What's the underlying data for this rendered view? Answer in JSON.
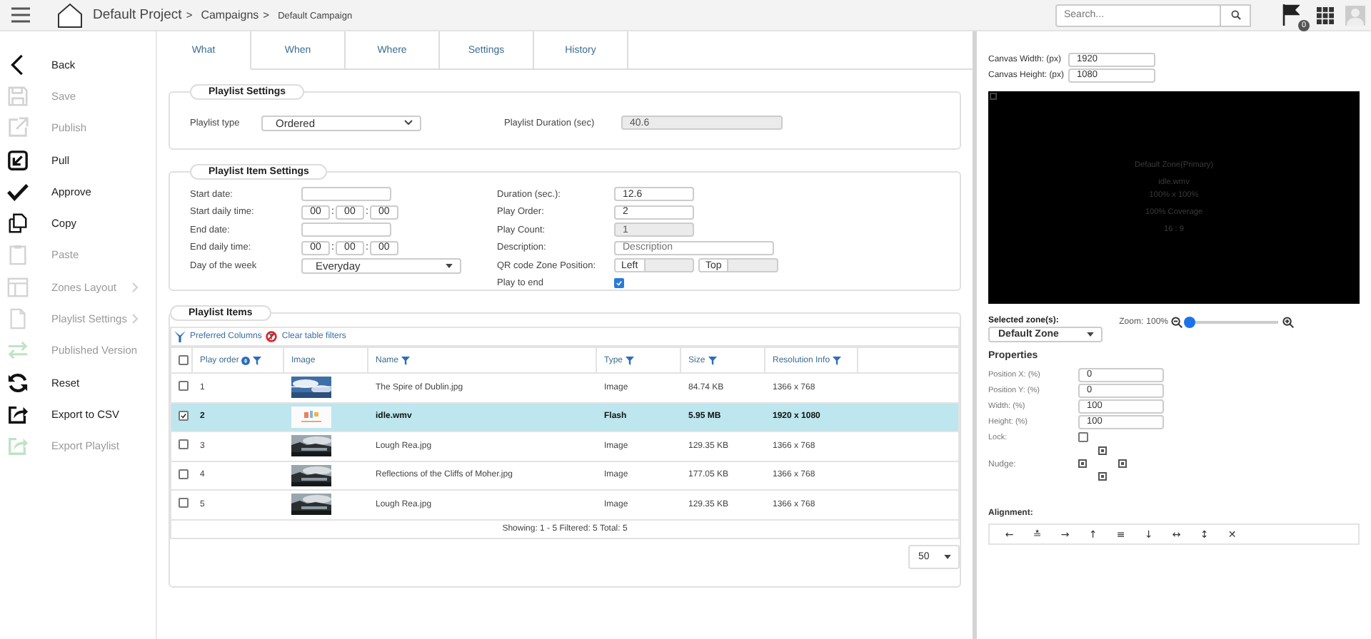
{
  "breadcrumbs": [
    {
      "label": "Default Project",
      "separator": ">"
    },
    {
      "label": "Campaigns",
      "separator": ">"
    },
    {
      "label": "Default Campaign"
    }
  ],
  "search": {
    "placeholder": "Search..."
  },
  "notifications": {
    "count": "0"
  },
  "sidebar": {
    "items": [
      {
        "label": "Back",
        "kind": "back",
        "disabled": false,
        "submenu": false
      },
      {
        "label": "Save",
        "kind": "save",
        "disabled": true,
        "submenu": false
      },
      {
        "label": "Publish",
        "kind": "publish",
        "disabled": true,
        "submenu": false
      },
      {
        "label": "Pull",
        "kind": "pull",
        "disabled": false,
        "submenu": false
      },
      {
        "label": "Approve",
        "kind": "approve",
        "disabled": false,
        "submenu": false
      },
      {
        "label": "Copy",
        "kind": "copy",
        "disabled": false,
        "submenu": false
      },
      {
        "label": "Paste",
        "kind": "paste",
        "disabled": true,
        "submenu": false
      },
      {
        "label": "Zones Layout",
        "kind": "layout",
        "disabled": true,
        "submenu": true
      },
      {
        "label": "Playlist Settings",
        "kind": "file",
        "disabled": true,
        "submenu": true
      },
      {
        "label": "Published Version",
        "kind": "versions",
        "disabled": true,
        "submenu": false
      },
      {
        "label": "Reset",
        "kind": "reset",
        "disabled": false,
        "submenu": false
      },
      {
        "label": "Export to CSV",
        "kind": "export",
        "disabled": false,
        "submenu": false
      },
      {
        "label": "Export Playlist",
        "kind": "export",
        "disabled": true,
        "submenu": false
      }
    ]
  },
  "tabs": [
    {
      "label": "What",
      "selected": true
    },
    {
      "label": "When",
      "selected": false
    },
    {
      "label": "Where",
      "selected": false
    },
    {
      "label": "Settings",
      "selected": false
    },
    {
      "label": "History",
      "selected": false
    }
  ],
  "playlist_settings": {
    "title": "Playlist Settings",
    "type_label": "Playlist type",
    "type_value": "Ordered",
    "duration_label": "Playlist Duration (sec)",
    "duration_value": "40.6"
  },
  "item_settings": {
    "title": "Playlist Item Settings",
    "left": [
      {
        "label": "Start date:",
        "kind": "date"
      },
      {
        "label": "Start daily time:",
        "kind": "time",
        "values": [
          "00",
          "00",
          "00"
        ],
        "separator": ":"
      },
      {
        "label": "End date:",
        "kind": "date"
      },
      {
        "label": "End daily time:",
        "kind": "time",
        "values": [
          "00",
          "00",
          "00"
        ],
        "separator": ":"
      },
      {
        "label": "Day of the week",
        "kind": "select",
        "value": "Everyday"
      }
    ],
    "right": [
      {
        "label": "Duration (sec.):",
        "kind": "text",
        "value": "12.6"
      },
      {
        "label": "Play Order:",
        "kind": "text",
        "value": "2"
      },
      {
        "label": "Play Count:",
        "kind": "readonly",
        "value": "1"
      },
      {
        "label": "Description:",
        "kind": "wide",
        "placeholder": "Description"
      },
      {
        "label": "QR code Zone Position:",
        "kind": "qr",
        "parts": [
          "Left",
          "Top"
        ]
      },
      {
        "label": "Play to end",
        "kind": "checkbox",
        "checked": true
      }
    ]
  },
  "playlist_items": {
    "title": "Playlist Items",
    "preferred_columns": "Preferred Columns",
    "clear_filters": "Clear table filters",
    "header_checked": false,
    "columns": [
      {
        "label": "Play order",
        "sort": true,
        "filter": true
      },
      {
        "label": "Image",
        "sort": false,
        "filter": false
      },
      {
        "label": "Name",
        "sort": false,
        "filter": true
      },
      {
        "label": "Type",
        "sort": false,
        "filter": true
      },
      {
        "label": "Size",
        "sort": false,
        "filter": true
      },
      {
        "label": "Resolution Info",
        "sort": false,
        "filter": true
      }
    ],
    "rows": [
      {
        "selected": false,
        "order": "1",
        "name": "The Spire of Dublin.jpg",
        "type": "Image",
        "size": "84.74 KB",
        "resolution": "1366 x 768"
      },
      {
        "selected": true,
        "order": "2",
        "name": "idle.wmv",
        "type": "Flash",
        "size": "5.95 MB",
        "resolution": "1920 x 1080"
      },
      {
        "selected": false,
        "order": "3",
        "name": "Lough Rea.jpg",
        "type": "Image",
        "size": "129.35 KB",
        "resolution": "1366 x 768"
      },
      {
        "selected": false,
        "order": "4",
        "name": "Reflections of the Cliffs of Moher.jpg",
        "type": "Image",
        "size": "177.05 KB",
        "resolution": "1366 x 768"
      },
      {
        "selected": false,
        "order": "5",
        "name": "Lough Rea.jpg",
        "type": "Image",
        "size": "129.35 KB",
        "resolution": "1366 x 768"
      }
    ],
    "footer": "Showing: 1 - 5 Filtered: 5 Total: 5",
    "page_size": "50"
  },
  "canvas": {
    "width_label": "Canvas Width:  (px)",
    "width_value": "1920",
    "height_label": "Canvas Height: (px)",
    "height_value": "1080",
    "preview": [
      "Default Zone(Primary)",
      "idle.wmv",
      "100% x 100%",
      "100% Coverage",
      "16 : 9"
    ]
  },
  "zone": {
    "label": "Selected zone(s):",
    "value": "Default Zone",
    "zoom_label": "Zoom:",
    "zoom_reading": "100%",
    "level": 0.0
  },
  "properties": {
    "title": "Properties",
    "fields": [
      {
        "label": "Position X: (%)",
        "value": "0"
      },
      {
        "label": "Position Y: (%)",
        "value": "0"
      },
      {
        "label": "Width: (%)",
        "value": "100"
      },
      {
        "label": "Height: (%)",
        "value": "100"
      }
    ],
    "lock_label": "Lock:",
    "lock_checked": false,
    "nudge_label": "Nudge:"
  },
  "alignment": {
    "label": "Alignment:",
    "buttons": [
      "←",
      "≛",
      "→",
      "↑",
      "≡",
      "↓",
      "↔",
      "↕",
      "✕"
    ]
  }
}
